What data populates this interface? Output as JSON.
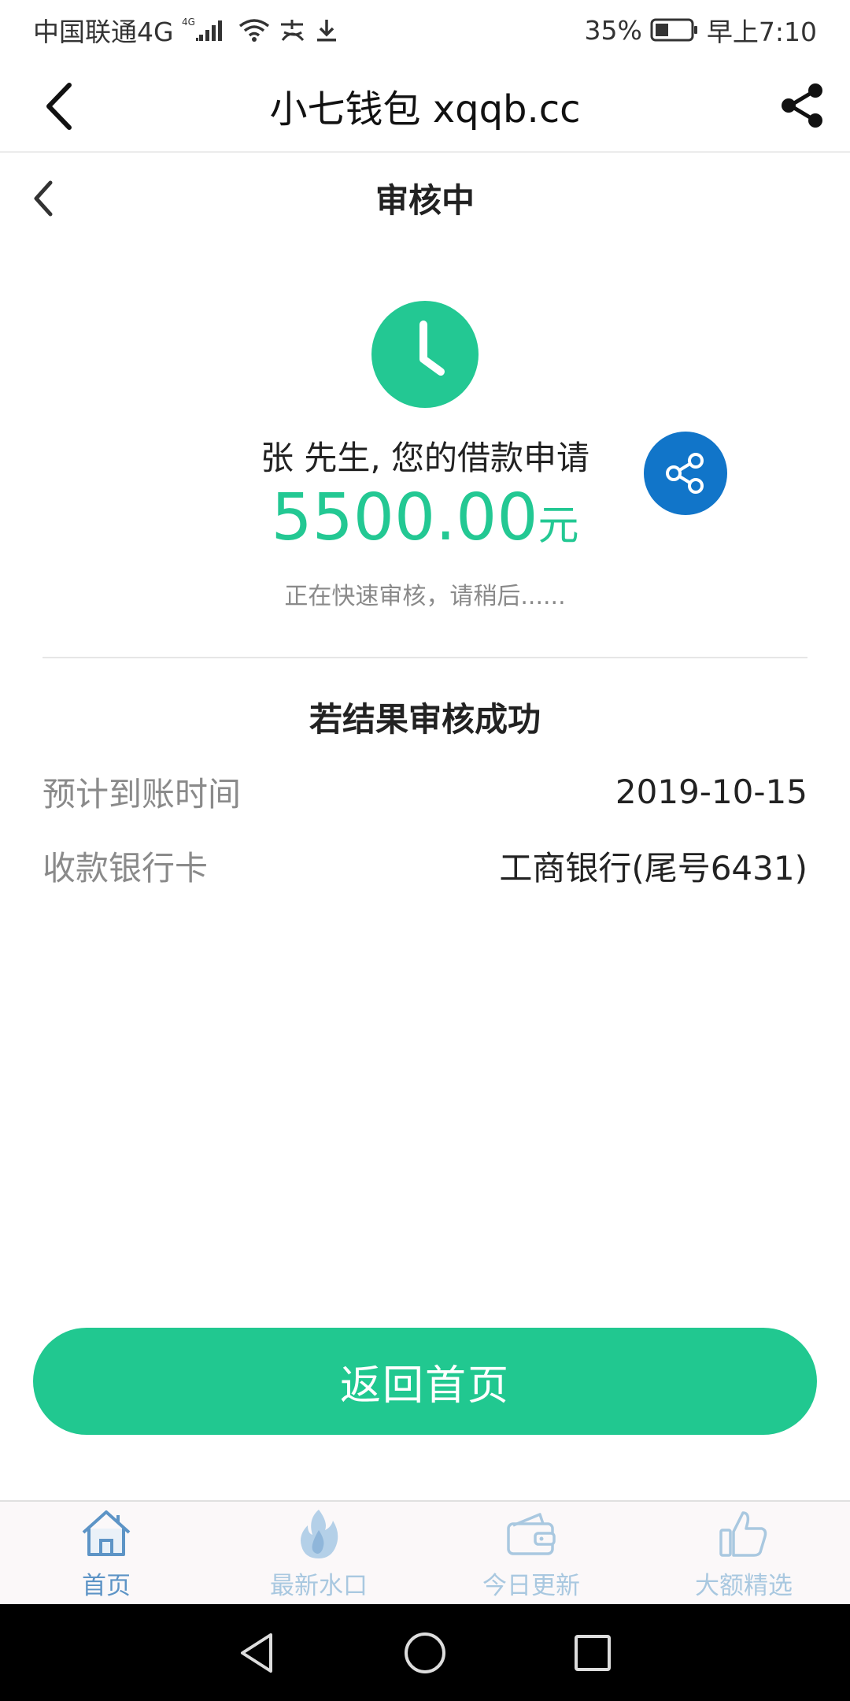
{
  "status_bar": {
    "carrier": "中国联通4G",
    "net_badge": "4G",
    "battery": "35%",
    "time": "早上7:10"
  },
  "header": {
    "title": "小七钱包 xqqb.cc"
  },
  "subheader": {
    "title": "审核中"
  },
  "status": {
    "greeting": "张 先生, 您的借款申请",
    "amount": "5500.00",
    "unit": "元",
    "note": "正在快速审核，请稍后......"
  },
  "result": {
    "title": "若结果审核成功",
    "rows": [
      {
        "label": "预计到账时间",
        "value": "2019-10-15"
      },
      {
        "label": "收款银行卡",
        "value": "工商银行(尾号6431)"
      }
    ]
  },
  "button": {
    "label": "返回首页"
  },
  "tabs": [
    {
      "label": "首页",
      "icon": "home-icon"
    },
    {
      "label": "最新水口",
      "icon": "fire-icon"
    },
    {
      "label": "今日更新",
      "icon": "wallet-icon"
    },
    {
      "label": "大额精选",
      "icon": "thumbs-up-icon"
    }
  ],
  "colors": {
    "accent": "#21c890",
    "share_blue": "#1175c9",
    "tab_active": "#5d94c6",
    "tab_inactive": "#a9c8e0"
  }
}
